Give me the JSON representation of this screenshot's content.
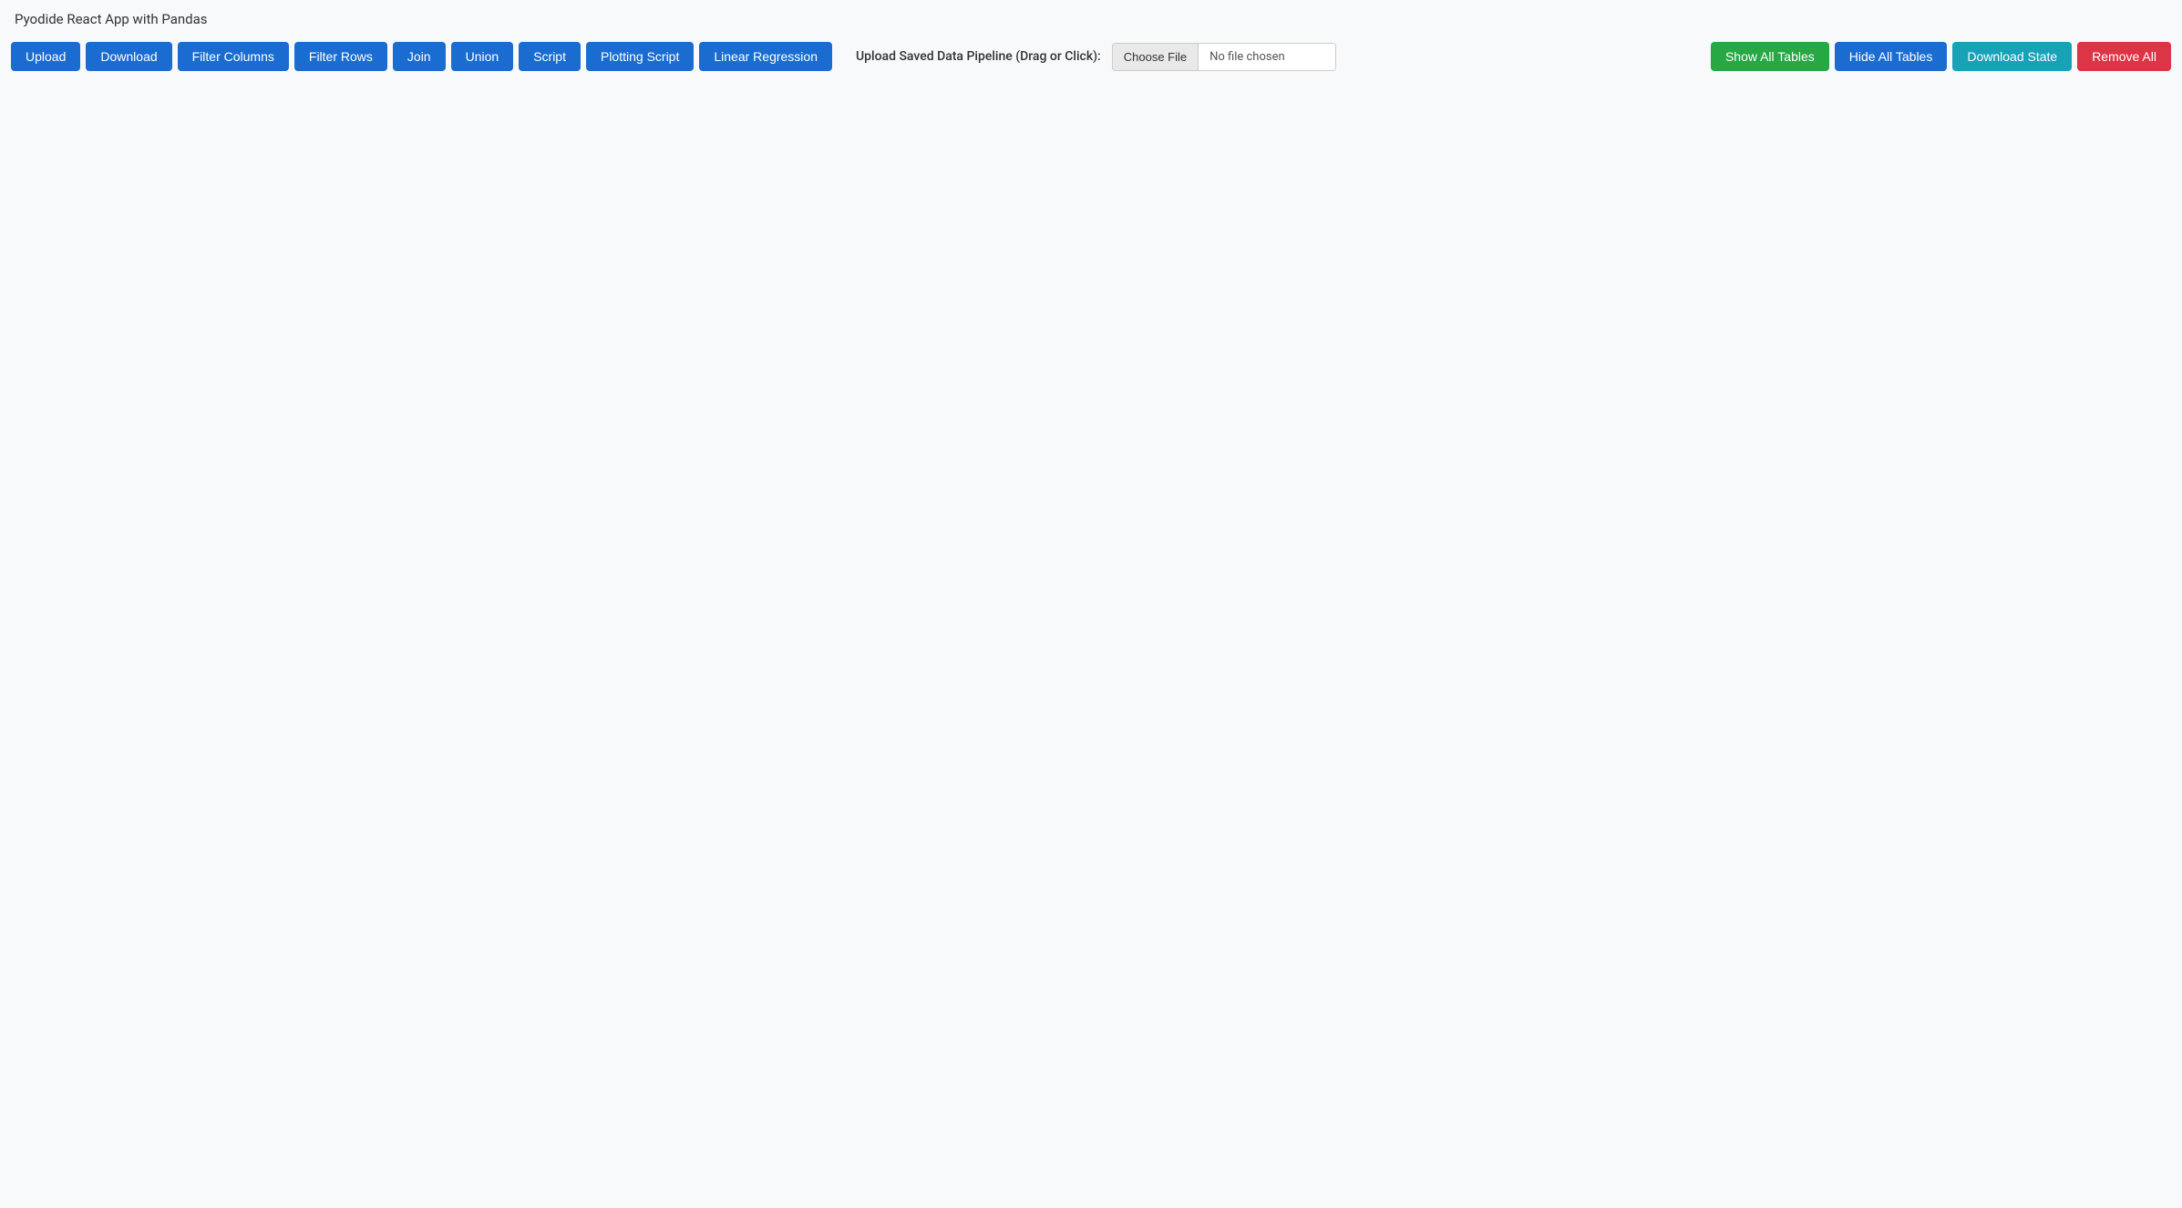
{
  "app": {
    "title": "Pyodide React App with Pandas"
  },
  "toolbar": {
    "left_buttons": [
      {
        "id": "upload",
        "label": "Upload",
        "style": "btn-blue"
      },
      {
        "id": "download",
        "label": "Download",
        "style": "btn-blue"
      },
      {
        "id": "filter-columns",
        "label": "Filter Columns",
        "style": "btn-blue"
      },
      {
        "id": "filter-rows",
        "label": "Filter Rows",
        "style": "btn-blue"
      },
      {
        "id": "join",
        "label": "Join",
        "style": "btn-blue"
      },
      {
        "id": "union",
        "label": "Union",
        "style": "btn-blue"
      },
      {
        "id": "script",
        "label": "Script",
        "style": "btn-blue"
      },
      {
        "id": "plotting-script",
        "label": "Plotting Script",
        "style": "btn-blue"
      },
      {
        "id": "linear-regression",
        "label": "Linear Regression",
        "style": "btn-blue"
      }
    ],
    "upload_section": {
      "label": "Upload Saved Data Pipeline (Drag or Click):",
      "choose_file_label": "Choose File",
      "no_file_text": "No file chosen"
    },
    "right_buttons": [
      {
        "id": "show-all-tables",
        "label": "Show All Tables",
        "style": "btn-green"
      },
      {
        "id": "hide-all-tables",
        "label": "Hide All Tables",
        "style": "btn-blue"
      },
      {
        "id": "download-state",
        "label": "Download State",
        "style": "btn-teal"
      },
      {
        "id": "remove-all",
        "label": "Remove All",
        "style": "btn-red"
      }
    ]
  }
}
